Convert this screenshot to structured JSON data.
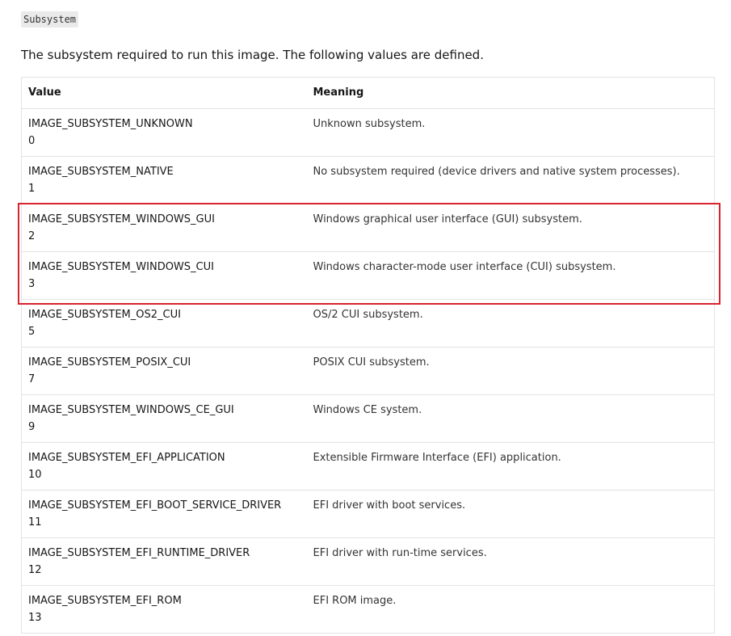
{
  "code_term": "Subsystem",
  "intro_text": "The subsystem required to run this image. The following values are defined.",
  "table": {
    "headers": {
      "value": "Value",
      "meaning": "Meaning"
    },
    "rows": [
      {
        "name": "IMAGE_SUBSYSTEM_UNKNOWN",
        "number": "0",
        "meaning": "Unknown subsystem."
      },
      {
        "name": "IMAGE_SUBSYSTEM_NATIVE",
        "number": "1",
        "meaning": "No subsystem required (device drivers and native system processes)."
      },
      {
        "name": "IMAGE_SUBSYSTEM_WINDOWS_GUI",
        "number": "2",
        "meaning": "Windows graphical user interface (GUI) subsystem."
      },
      {
        "name": "IMAGE_SUBSYSTEM_WINDOWS_CUI",
        "number": "3",
        "meaning": "Windows character-mode user interface (CUI) subsystem."
      },
      {
        "name": "IMAGE_SUBSYSTEM_OS2_CUI",
        "number": "5",
        "meaning": "OS/2 CUI subsystem."
      },
      {
        "name": "IMAGE_SUBSYSTEM_POSIX_CUI",
        "number": "7",
        "meaning": "POSIX CUI subsystem."
      },
      {
        "name": "IMAGE_SUBSYSTEM_WINDOWS_CE_GUI",
        "number": "9",
        "meaning": "Windows CE system."
      },
      {
        "name": "IMAGE_SUBSYSTEM_EFI_APPLICATION",
        "number": "10",
        "meaning": "Extensible Firmware Interface (EFI) application."
      },
      {
        "name": "IMAGE_SUBSYSTEM_EFI_BOOT_SERVICE_DRIVER",
        "number": "11",
        "meaning": "EFI driver with boot services."
      },
      {
        "name": "IMAGE_SUBSYSTEM_EFI_RUNTIME_DRIVER",
        "number": "12",
        "meaning": "EFI driver with run-time services."
      },
      {
        "name": "IMAGE_SUBSYSTEM_EFI_ROM",
        "number": "13",
        "meaning": "EFI ROM image."
      }
    ]
  },
  "highlight": {
    "color": "#d9232d"
  }
}
